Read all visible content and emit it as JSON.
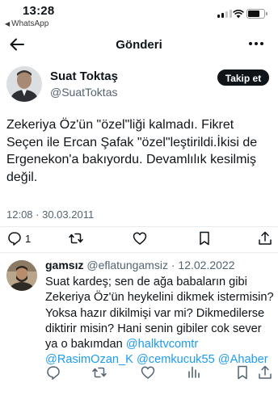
{
  "status_bar": {
    "time": "13:28",
    "back_app": "WhatsApp",
    "back_icon": "triangle-left-icon"
  },
  "header": {
    "title": "Gönderi",
    "back_icon": "arrow-left-icon",
    "more_icon": "more-horizontal-icon"
  },
  "tweet": {
    "author_name": "Suat Toktaş",
    "author_handle": "@SuatToktas",
    "follow_label": "Takip et",
    "text": "Zekeriya Öz'ün \"özel\"liği kalmadı. Fikret Seçen ile Ercan Şafak \"özel\"leştirildi.İkisi de Ergenekon'a bakıyordu. Devamlılık kesilmiş değil.",
    "timestamp": "12:08 · 30.03.2011",
    "reply_count": "1",
    "actions": [
      "reply-icon",
      "retweet-icon",
      "like-icon",
      "bookmark-icon",
      "share-icon"
    ]
  },
  "reply": {
    "author_name": "gamsız",
    "author_handle": "@eflatungamsiz",
    "separator": "·",
    "date": "12.02.2022",
    "text_plain": "Suat kardeş; sen de ağa babaların gibi Zekeriya Öz'ün heykelini dikmek istermisin? Yoksa hazır dikilmişi var mi? Dikmedilerse diktirir misin? Hani senin gibiler cok sever ya o bakımdan",
    "mentions": [
      "@halktvcomtr",
      "@RasimOzan_K",
      "@cemkucuk55",
      "@Ahaber"
    ],
    "actions": [
      "reply-icon",
      "retweet-icon",
      "like-icon",
      "views-icon",
      "bookmark-icon",
      "share-icon"
    ]
  },
  "colors": {
    "text": "#0f1419",
    "secondary": "#536471",
    "link": "#1d9bf0",
    "follow_bg": "#0f1419",
    "divider": "#e6ecf0"
  }
}
